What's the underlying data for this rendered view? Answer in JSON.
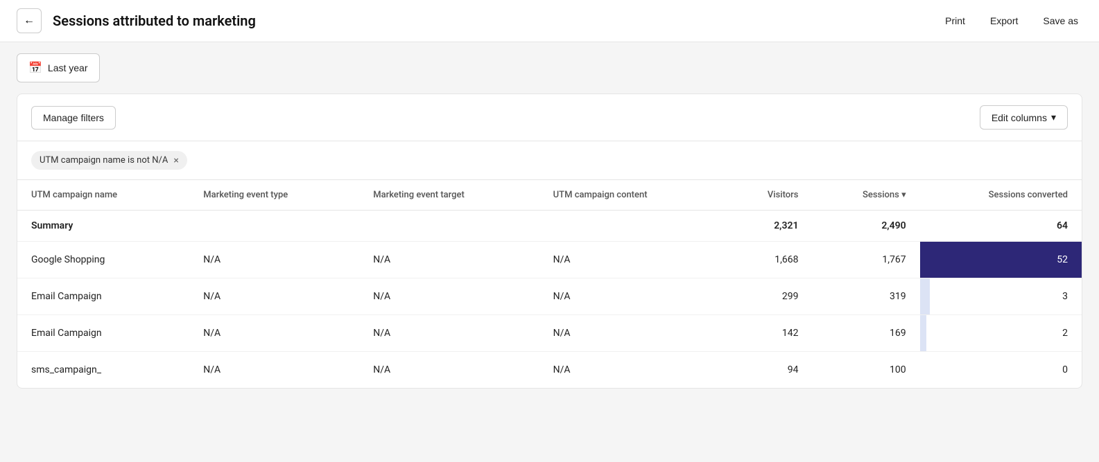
{
  "header": {
    "back_label": "←",
    "title": "Sessions attributed to marketing",
    "print_label": "Print",
    "export_label": "Export",
    "save_as_label": "Save as"
  },
  "filter_bar": {
    "date_label": "Last year",
    "calendar_icon": "📅"
  },
  "card": {
    "manage_filters_label": "Manage filters",
    "edit_columns_label": "Edit columns",
    "edit_columns_icon": "▾",
    "active_filter": {
      "text": "UTM campaign name is not N/A",
      "close_icon": "×"
    }
  },
  "table": {
    "columns": [
      {
        "id": "utm_campaign_name",
        "label": "UTM campaign name",
        "align": "left"
      },
      {
        "id": "marketing_event_type",
        "label": "Marketing event type",
        "align": "left"
      },
      {
        "id": "marketing_event_target",
        "label": "Marketing event target",
        "align": "left"
      },
      {
        "id": "utm_campaign_content",
        "label": "UTM campaign content",
        "align": "left"
      },
      {
        "id": "visitors",
        "label": "Visitors",
        "align": "right"
      },
      {
        "id": "sessions",
        "label": "Sessions ▾",
        "align": "right"
      },
      {
        "id": "sessions_converted",
        "label": "Sessions converted",
        "align": "right"
      }
    ],
    "summary": {
      "label": "Summary",
      "visitors": "2,321",
      "sessions": "2,490",
      "sessions_converted": "64"
    },
    "rows": [
      {
        "utm_campaign_name": "Google Shopping",
        "marketing_event_type": "N/A",
        "marketing_event_target": "N/A",
        "utm_campaign_content": "N/A",
        "visitors": "1,668",
        "sessions": "1,767",
        "sessions_converted": "52",
        "bar_pct": 100,
        "bar_color": "#2d2777",
        "white_text": true
      },
      {
        "utm_campaign_name": "Email Campaign",
        "marketing_event_type": "N/A",
        "marketing_event_target": "N/A",
        "utm_campaign_content": "N/A",
        "visitors": "299",
        "sessions": "319",
        "sessions_converted": "3",
        "bar_pct": 6,
        "bar_color": "#dce3f5",
        "white_text": false
      },
      {
        "utm_campaign_name": "Email Campaign",
        "marketing_event_type": "N/A",
        "marketing_event_target": "N/A",
        "utm_campaign_content": "N/A",
        "visitors": "142",
        "sessions": "169",
        "sessions_converted": "2",
        "bar_pct": 4,
        "bar_color": "#dce3f5",
        "white_text": false
      },
      {
        "utm_campaign_name": "sms_campaign_",
        "marketing_event_type": "N/A",
        "marketing_event_target": "N/A",
        "utm_campaign_content": "N/A",
        "visitors": "94",
        "sessions": "100",
        "sessions_converted": "0",
        "bar_pct": 0,
        "bar_color": "#dce3f5",
        "white_text": false
      }
    ]
  }
}
